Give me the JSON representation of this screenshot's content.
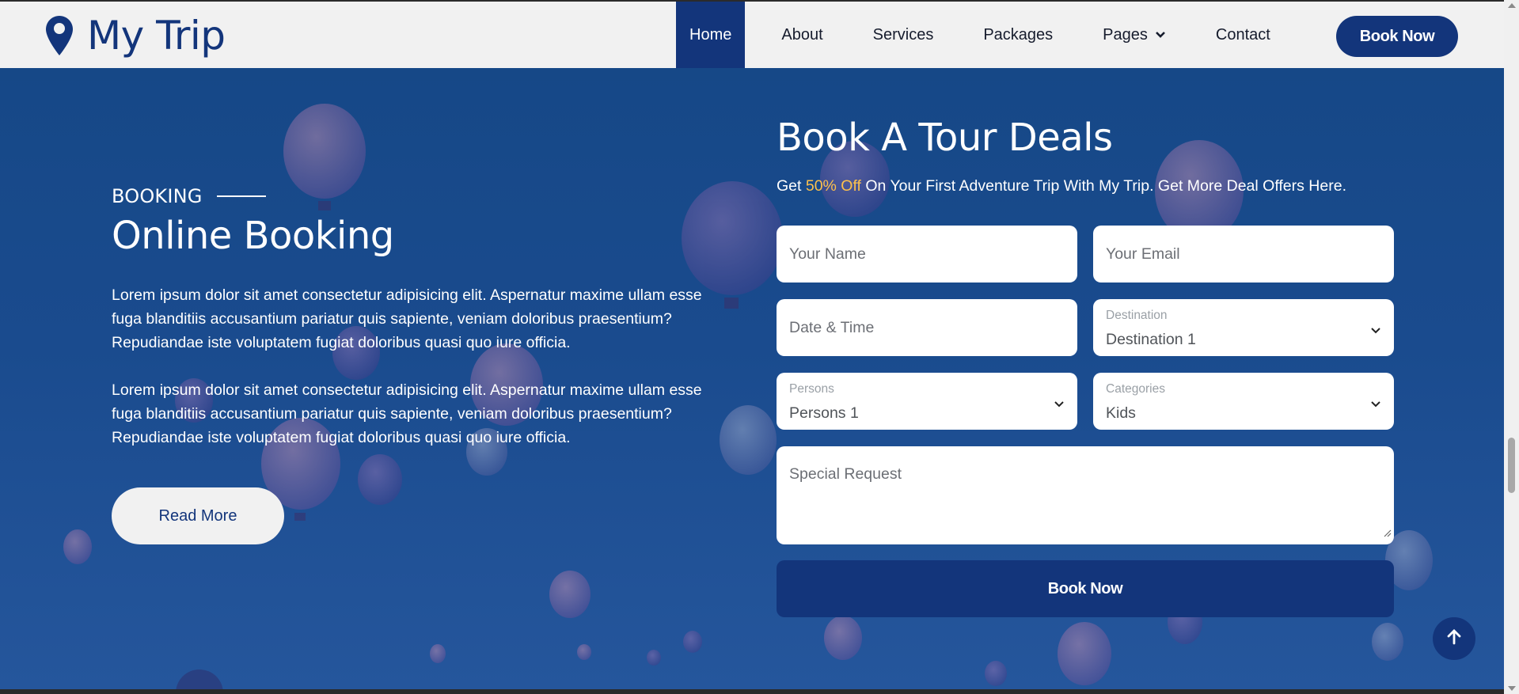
{
  "brand": {
    "name": "My Trip",
    "icon": "map-pin-icon"
  },
  "nav": {
    "items": [
      {
        "label": "Home",
        "active": true
      },
      {
        "label": "About"
      },
      {
        "label": "Services"
      },
      {
        "label": "Packages"
      },
      {
        "label": "Pages",
        "has_dropdown": true
      },
      {
        "label": "Contact"
      }
    ],
    "book_now": "Book Now"
  },
  "booking": {
    "eyebrow": "BOOKING",
    "title": "Online Booking",
    "paragraph_1": "Lorem ipsum dolor sit amet consectetur adipisicing elit. Aspernatur maxime ullam esse fuga blanditiis accusantium pariatur quis sapiente, veniam doloribus praesentium? Repudiandae iste voluptatem fugiat doloribus quasi quo iure officia.",
    "paragraph_2": "Lorem ipsum dolor sit amet consectetur adipisicing elit. Aspernatur maxime ullam esse fuga blanditiis accusantium pariatur quis sapiente, veniam doloribus praesentium? Repudiandae iste voluptatem fugiat doloribus quasi quo iure officia.",
    "read_more": "Read More"
  },
  "form": {
    "title": "Book A Tour Deals",
    "subtitle_prefix": "Get ",
    "subtitle_highlight": "50% Off",
    "subtitle_suffix": " On Your First Adventure Trip With My Trip. Get More Deal Offers Here.",
    "name_placeholder": "Your Name",
    "email_placeholder": "Your Email",
    "datetime_placeholder": "Date & Time",
    "destination": {
      "label": "Destination",
      "value": "Destination 1"
    },
    "persons": {
      "label": "Persons",
      "value": "Persons 1"
    },
    "categories": {
      "label": "Categories",
      "value": "Kids"
    },
    "special_request_placeholder": "Special Request",
    "submit": "Book Now"
  },
  "colors": {
    "primary": "#13357b",
    "highlight": "#fdc04c",
    "nav_bg": "#f1f1f1"
  }
}
